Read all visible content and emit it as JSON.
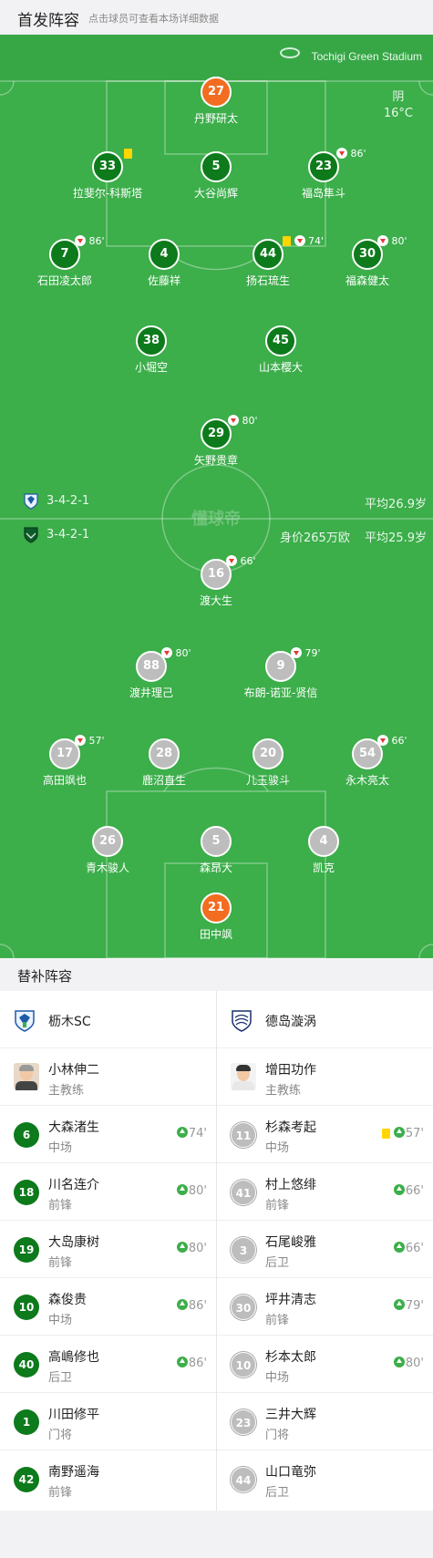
{
  "header": {
    "title": "首发阵容",
    "subtitle": "点击球员可查看本场详细数据"
  },
  "match": {
    "stadium": "Tochigi Green Stadium",
    "weather": "阴",
    "temperature": "16°C",
    "watermark": "懂球帝"
  },
  "away_team": {
    "formation": "3-4-2-1",
    "avg_age": "平均26.9岁"
  },
  "home_team": {
    "formation": "3-4-2-1",
    "value": "身价265万欧",
    "avg_age": "平均25.9岁"
  },
  "top_players": [
    {
      "number": "27",
      "name": "丹野研太",
      "gk": true
    },
    {
      "number": "33",
      "name": "拉斐尔-科斯塔",
      "card": true
    },
    {
      "number": "5",
      "name": "大谷尚辉"
    },
    {
      "number": "23",
      "name": "福岛隼斗",
      "sub": "86'"
    },
    {
      "number": "7",
      "name": "石田凌太郎",
      "sub": "86'"
    },
    {
      "number": "4",
      "name": "佐藤祥"
    },
    {
      "number": "44",
      "name": "扬石琉生",
      "card": true,
      "sub": "74'"
    },
    {
      "number": "30",
      "name": "福森健太",
      "sub": "80'"
    },
    {
      "number": "38",
      "name": "小堀空"
    },
    {
      "number": "45",
      "name": "山本樱大"
    },
    {
      "number": "29",
      "name": "矢野贵章",
      "sub": "80'"
    }
  ],
  "bottom_players": [
    {
      "number": "16",
      "name": "渡大生",
      "sub": "66'"
    },
    {
      "number": "88",
      "name": "渡井理己",
      "sub": "80'"
    },
    {
      "number": "9",
      "name": "布朗-诺亚-贤信",
      "sub": "79'"
    },
    {
      "number": "17",
      "name": "高田飒也",
      "sub": "57'"
    },
    {
      "number": "28",
      "name": "鹿沼直生"
    },
    {
      "number": "20",
      "name": "儿玉骏斗"
    },
    {
      "number": "54",
      "name": "永木亮太",
      "sub": "66'"
    },
    {
      "number": "26",
      "name": "青木骏人"
    },
    {
      "number": "5",
      "name": "森昂大"
    },
    {
      "number": "4",
      "name": "凯克"
    },
    {
      "number": "21",
      "name": "田中飒",
      "gk": true
    }
  ],
  "subs": {
    "title": "替补阵容",
    "left": {
      "team": "枥木SC",
      "coach": {
        "name": "小林伸二",
        "role": "主教练"
      },
      "players": [
        {
          "number": "6",
          "name": "大森渚生",
          "pos": "中场",
          "sub": "74'"
        },
        {
          "number": "18",
          "name": "川名连介",
          "pos": "前锋",
          "sub": "80'"
        },
        {
          "number": "19",
          "name": "大岛康树",
          "pos": "前锋",
          "sub": "80'"
        },
        {
          "number": "10",
          "name": "森俊贵",
          "pos": "中场",
          "sub": "86'"
        },
        {
          "number": "40",
          "name": "高嶋修也",
          "pos": "后卫",
          "sub": "86'"
        },
        {
          "number": "1",
          "name": "川田修平",
          "pos": "门将",
          "sub": ""
        },
        {
          "number": "42",
          "name": "南野遥海",
          "pos": "前锋",
          "sub": ""
        }
      ]
    },
    "right": {
      "team": "德岛漩涡",
      "coach": {
        "name": "增田功作",
        "role": "主教练"
      },
      "players": [
        {
          "number": "11",
          "name": "杉森考起",
          "pos": "中场",
          "sub": "57'",
          "card": true
        },
        {
          "number": "41",
          "name": "村上悠绯",
          "pos": "前锋",
          "sub": "66'"
        },
        {
          "number": "3",
          "name": "石尾峻雅",
          "pos": "后卫",
          "sub": "66'"
        },
        {
          "number": "30",
          "name": "坪井清志",
          "pos": "前锋",
          "sub": "79'"
        },
        {
          "number": "10",
          "name": "杉本太郎",
          "pos": "中场",
          "sub": "80'"
        },
        {
          "number": "23",
          "name": "三井大辉",
          "pos": "门将",
          "sub": ""
        },
        {
          "number": "44",
          "name": "山口竜弥",
          "pos": "后卫",
          "sub": ""
        }
      ]
    }
  },
  "colors": {
    "pitch": "#3cae4a",
    "home": "#0d7a1b",
    "away": "#bdbdbd",
    "gk": "#f26d21",
    "card": "#ffd600"
  }
}
